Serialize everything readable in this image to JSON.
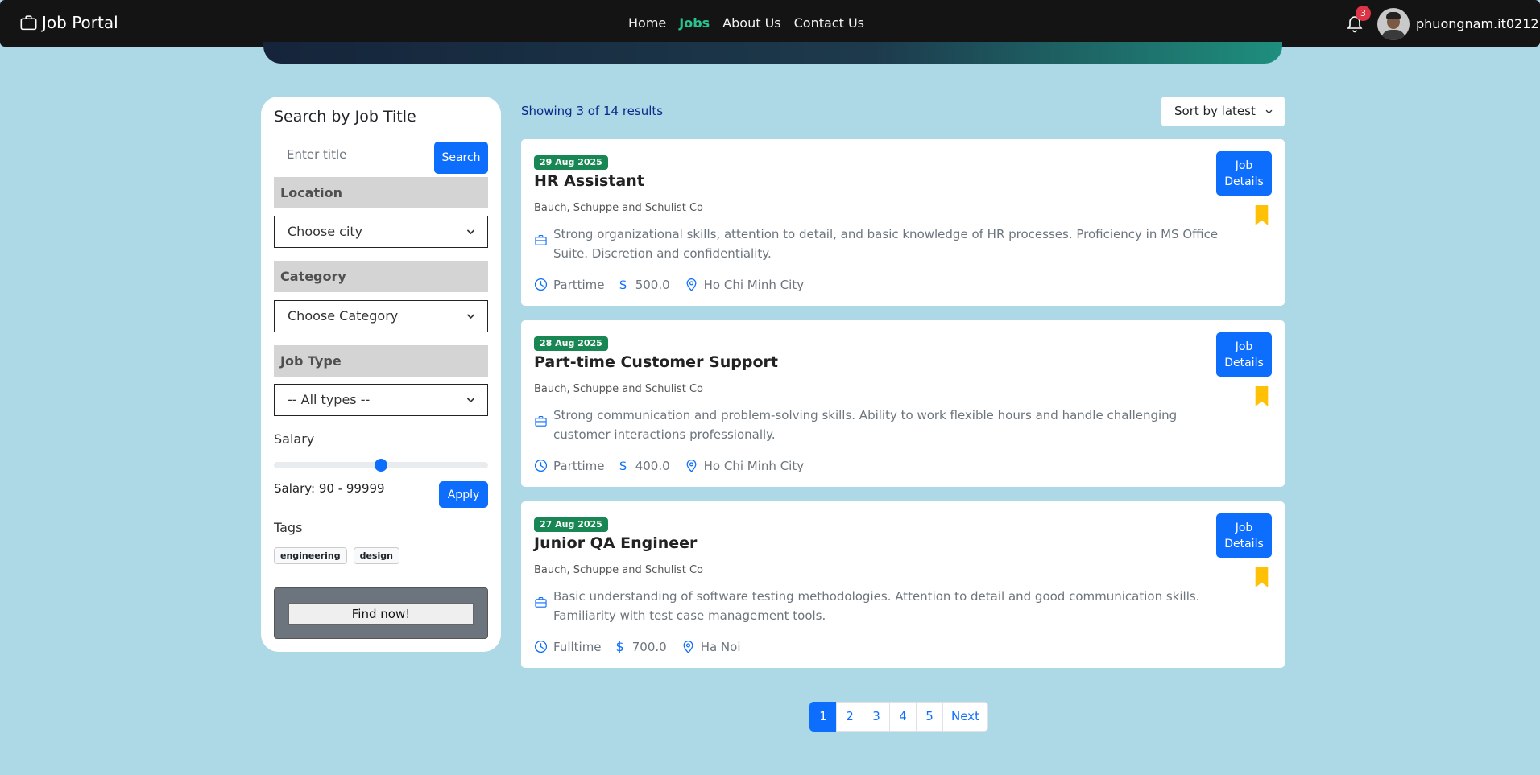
{
  "navbar": {
    "brand": "Job Portal",
    "links": [
      {
        "label": "Home",
        "active": false
      },
      {
        "label": "Jobs",
        "active": true
      },
      {
        "label": "About Us",
        "active": false
      },
      {
        "label": "Contact Us",
        "active": false
      }
    ],
    "notification_count": "3",
    "username": "phuongnam.it0212",
    "icons": {
      "brand": "briefcase-icon",
      "notifications": "bell-icon",
      "avatar": "user-avatar"
    }
  },
  "sidebar": {
    "title": "Search by Job Title",
    "title_placeholder": "Enter title",
    "search_label": "Search",
    "location_header": "Location",
    "location_value": "Choose city",
    "category_header": "Category",
    "category_value": "Choose Category",
    "jobtype_header": "Job Type",
    "jobtype_value": "-- All types --",
    "salary_label": "Salary",
    "salary_slider_value": 0.5,
    "salary_range_text": "Salary: 90 - 99999",
    "apply_label": "Apply",
    "tags_label": "Tags",
    "tags": [
      "engineering",
      "design"
    ],
    "find_label": "Find now!"
  },
  "results": {
    "showing_text": "Showing 3 of 14 results",
    "sort_label": "Sort by latest"
  },
  "jobs": [
    {
      "date": "29 Aug 2025",
      "title": "HR Assistant",
      "company": "Bauch, Schuppe and Schulist Co",
      "description": "Strong organizational skills, attention to detail, and basic knowledge of HR processes. Proficiency in MS Office Suite. Discretion and confidentiality.",
      "type": "Parttime",
      "salary": "500.0",
      "location": "Ho Chi Minh City",
      "details_label": "Job Details"
    },
    {
      "date": "28 Aug 2025",
      "title": "Part-time Customer Support",
      "company": "Bauch, Schuppe and Schulist Co",
      "description": "Strong communication and problem-solving skills. Ability to work flexible hours and handle challenging customer interactions professionally.",
      "type": "Parttime",
      "salary": "400.0",
      "location": "Ho Chi Minh City",
      "details_label": "Job Details"
    },
    {
      "date": "27 Aug 2025",
      "title": "Junior QA Engineer",
      "company": "Bauch, Schuppe and Schulist Co",
      "description": "Basic understanding of software testing methodologies. Attention to detail and good communication skills. Familiarity with test case management tools.",
      "type": "Fulltime",
      "salary": "700.0",
      "location": "Ha Noi",
      "details_label": "Job Details"
    }
  ],
  "pagination": {
    "pages": [
      "1",
      "2",
      "3",
      "4",
      "5"
    ],
    "active": "1",
    "next_label": "Next"
  },
  "colors": {
    "page_bg": "#add8e6",
    "navbar_bg": "#141414",
    "active_nav": "#28c38f",
    "primary": "#0d6efd",
    "date_badge": "#198754",
    "bookmark": "#ffc107",
    "notification_badge": "#dc3545"
  }
}
